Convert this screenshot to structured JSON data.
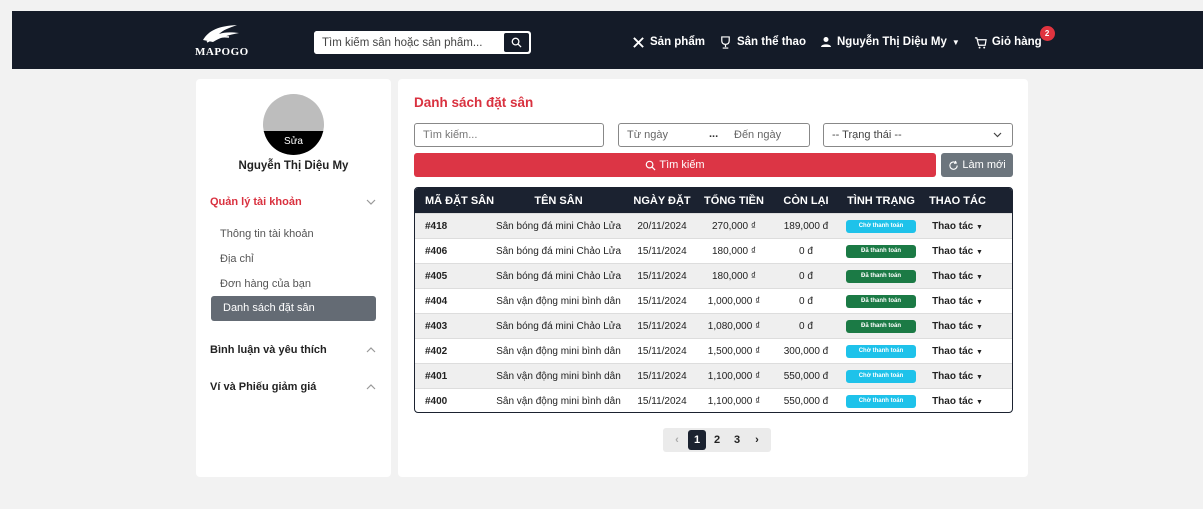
{
  "header": {
    "logo_text": "MAPOGO",
    "search_placeholder": "Tìm kiếm sân hoặc sản phẩm...",
    "nav": {
      "products": "Sản phẩm",
      "fields": "Sân thể thao",
      "user": "Nguyễn Thị Diệu My",
      "cart": "Giỏ hàng",
      "cart_count": "2"
    }
  },
  "sidebar": {
    "avatar_edit": "Sửa",
    "user_name": "Nguyễn Thị Diệu My",
    "account_group": "Quản lý tài khoản",
    "items": [
      "Thông tin tài khoản",
      "Địa chỉ",
      "Đơn hàng của bạn",
      "Danh sách đặt sân"
    ],
    "comments_group": "Bình luận và yêu thích",
    "wallet_group": "Ví và Phiếu giảm giá"
  },
  "main": {
    "title": "Danh sách đặt sân",
    "search_placeholder": "Tìm kiếm...",
    "from_date": "Từ ngày",
    "date_sep": "...",
    "to_date": "Đến ngày",
    "status_select": "-- Trạng thái --",
    "search_button": "Tìm kiếm",
    "reset_button": "Làm mới",
    "columns": [
      "MÃ ĐẶT SÂN",
      "TÊN SÂN",
      "NGÀY ĐẶT",
      "TỔNG TIỀN",
      "CÒN LẠI",
      "TÌNH TRẠNG",
      "THAO TÁC"
    ],
    "rows": [
      {
        "id": "#418",
        "name": "Sân bóng đá mini Chảo Lửa",
        "date": "20/11/2024",
        "total": "270,000 ₫",
        "remaining": "189,000 đ",
        "status": "Chờ thanh toán",
        "action": "Thao tác"
      },
      {
        "id": "#406",
        "name": "Sân bóng đá mini Chảo Lửa",
        "date": "15/11/2024",
        "total": "180,000 ₫",
        "remaining": "0 đ",
        "status": "Đã thanh toán",
        "action": "Thao tác"
      },
      {
        "id": "#405",
        "name": "Sân bóng đá mini Chảo Lửa",
        "date": "15/11/2024",
        "total": "180,000 ₫",
        "remaining": "0 đ",
        "status": "Đã thanh toán",
        "action": "Thao tác"
      },
      {
        "id": "#404",
        "name": "Sân vận động mini bình dân",
        "date": "15/11/2024",
        "total": "1,000,000 ₫",
        "remaining": "0 đ",
        "status": "Đã thanh toán",
        "action": "Thao tác"
      },
      {
        "id": "#403",
        "name": "Sân bóng đá mini Chảo Lửa",
        "date": "15/11/2024",
        "total": "1,080,000 ₫",
        "remaining": "0 đ",
        "status": "Đã thanh toán",
        "action": "Thao tác"
      },
      {
        "id": "#402",
        "name": "Sân vận động mini bình dân",
        "date": "15/11/2024",
        "total": "1,500,000 ₫",
        "remaining": "300,000 đ",
        "status": "Chờ thanh toán",
        "action": "Thao tác"
      },
      {
        "id": "#401",
        "name": "Sân vận động mini bình dân",
        "date": "15/11/2024",
        "total": "1,100,000 ₫",
        "remaining": "550,000 đ",
        "status": "Chờ thanh toán",
        "action": "Thao tác"
      },
      {
        "id": "#400",
        "name": "Sân vận động mini bình dân",
        "date": "15/11/2024",
        "total": "1,100,000 ₫",
        "remaining": "550,000 đ",
        "status": "Chờ thanh toán",
        "action": "Thao tác"
      }
    ],
    "pagination": {
      "prev": "‹",
      "pages": [
        "1",
        "2",
        "3"
      ],
      "current": "1",
      "next": "›"
    }
  },
  "colors": {
    "accent_red": "#dc3545",
    "navbar_bg": "#141b28",
    "status_waiting": "#1ec2ea",
    "status_paid": "#1b7a45"
  }
}
